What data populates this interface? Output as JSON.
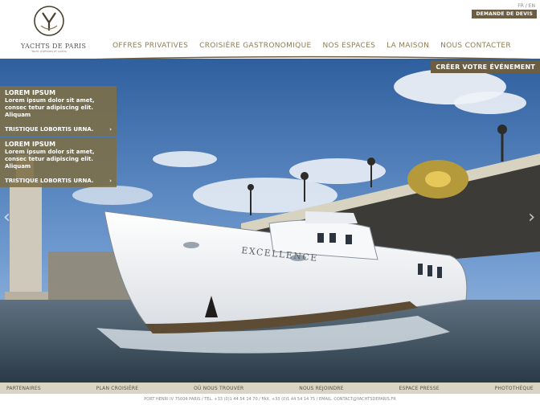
{
  "header": {
    "logo_name": "YACHTS DE PARIS",
    "logo_tagline": "Yacht d'Affaires et Loisirs",
    "lang": "FR / EN",
    "quote_button": "DEMANDE DE DEVIS"
  },
  "nav": {
    "items": [
      "OFFRES PRIVATIVES",
      "CROISIÈRE GASTRONOMIQUE",
      "NOS ESPACES",
      "LA MAISON",
      "NOUS CONTACTER"
    ]
  },
  "hero": {
    "create_button": "CRÉER VOTRE ÉVÉNEMENT",
    "boat_name": "EXCELLENCE",
    "promos": [
      {
        "title": "LOREM IPSUM",
        "text": "Lorem ipsum dolor sit amet, consec tetur adipiscing elit. Aliquam",
        "link": "TRISTIQUE LOBORTIS URNA."
      },
      {
        "title": "LOREM IPSUM",
        "text": "Lorem ipsum dolor sit amet, consec tetur adipiscing elit. Aliquam",
        "link": "TRISTIQUE LOBORTIS URNA."
      }
    ]
  },
  "footer": {
    "links": [
      "PARTENAIRES",
      "PLAN CROISIÈRE",
      "OÙ NOUS TROUVER",
      "NOUS REJOINDRE",
      "ESPACE PRESSE",
      "PHOTOTHÈQUE"
    ],
    "info": "PORT HENRI IV 75004 PARIS / TEL. +33 (0)1 44 54 14 70 / FAX. +33 (0)1 44 54 14 75 / EMAIL. CONTACT@YACHTSDEPARIS.FR"
  },
  "colors": {
    "brand": "#6b5e43",
    "nav": "#8e7e55",
    "footer_bg": "#d9d4c4"
  }
}
